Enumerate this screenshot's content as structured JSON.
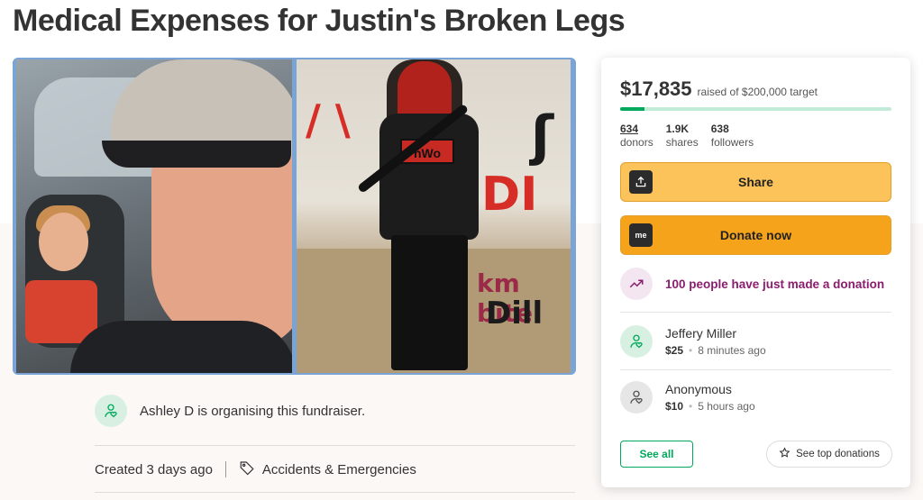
{
  "page": {
    "title": "Medical Expenses for Justin's Broken Legs"
  },
  "hero": {
    "graffiti_right": [
      "DI",
      "km bite",
      "Dill"
    ],
    "shirt_text": "nWo"
  },
  "organiser": {
    "text": "Ashley D is organising this fundraiser.",
    "icon": "person-heart-icon"
  },
  "meta": {
    "created": "Created 3 days ago",
    "category": "Accidents & Emergencies",
    "category_icon": "tag-icon"
  },
  "donation_card": {
    "amount": "$17,835",
    "raised_of": "raised of $200,000 target",
    "progress_fraction": 0.089,
    "colors": {
      "progress": "#02a95c",
      "progress_bg": "#c3ecd8",
      "button": "#f6a31c",
      "hint": "#8a1d6d"
    },
    "stats": [
      {
        "num": "634",
        "label": "donors"
      },
      {
        "num": "1.9K",
        "label": "shares"
      },
      {
        "num": "638",
        "label": "followers"
      }
    ],
    "share_label": "Share",
    "share_icon": "upload-share-icon",
    "donate_label": "Donate now",
    "donate_icon_text": "me",
    "hint": "100 people have just made a donation",
    "hint_icon": "trend-up-icon",
    "donors": [
      {
        "name": "Jeffery Miller",
        "amount": "$25",
        "time": "8 minutes ago",
        "icon": "person-heart-icon"
      },
      {
        "name": "Anonymous",
        "amount": "$10",
        "time": "5 hours ago",
        "icon": "person-heart-icon"
      }
    ],
    "see_all": "See all",
    "see_top": "See top donations",
    "see_top_icon": "star-icon"
  }
}
